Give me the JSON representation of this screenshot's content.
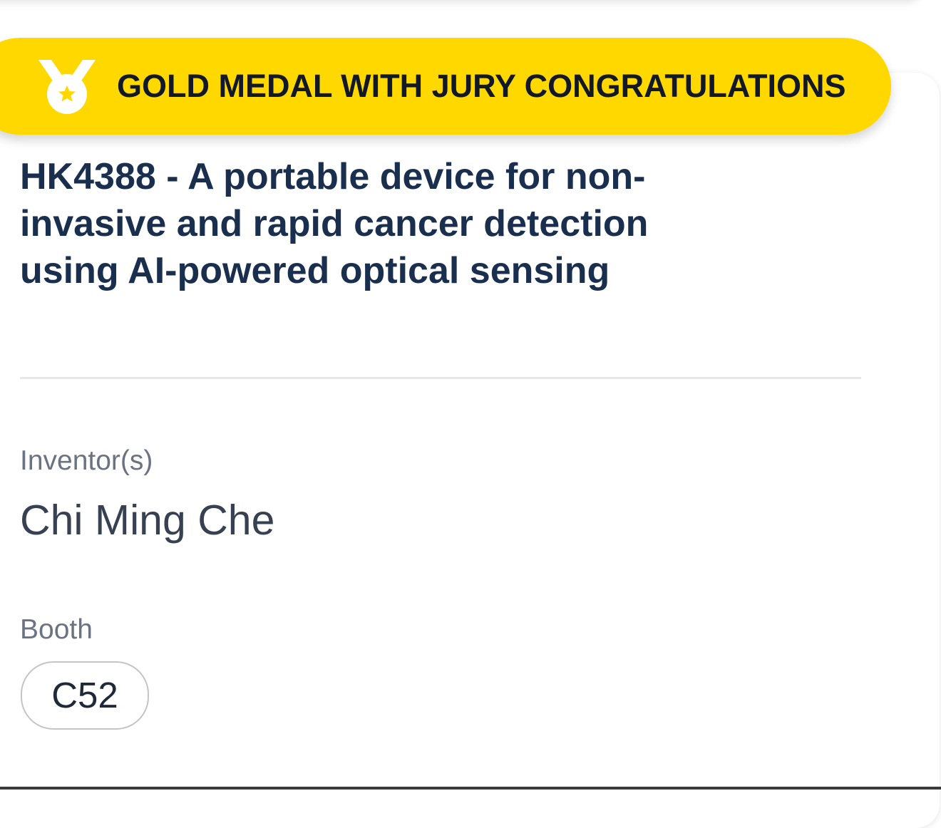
{
  "award": {
    "label": "GOLD MEDAL WITH JURY CONGRATULATIONS",
    "icon": "medal-icon",
    "color": "#ffd800"
  },
  "invention": {
    "title": "HK4388 - A portable device for non-invasive and rapid cancer detection using AI-powered optical sensing"
  },
  "inventors": {
    "label": "Inventor(s)",
    "value": "Chi Ming Che"
  },
  "booth": {
    "label": "Booth",
    "value": "C52"
  },
  "colors": {
    "title": "#1a2e4e",
    "label": "#6b7280",
    "text": "#374151"
  }
}
